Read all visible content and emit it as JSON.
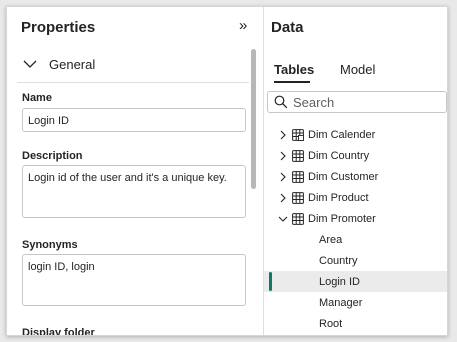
{
  "properties": {
    "title": "Properties",
    "collapse_glyph": "»",
    "section": {
      "label": "General"
    },
    "name": {
      "label": "Name",
      "value": "Login ID"
    },
    "description": {
      "label": "Description",
      "value": "Login id of the user and it's a unique key."
    },
    "synonyms": {
      "label": "Synonyms",
      "value": "login ID, login"
    },
    "next_label": "Display folder"
  },
  "data_pane": {
    "title": "Data",
    "tabs": [
      {
        "label": "Tables",
        "active": true
      },
      {
        "label": "Model",
        "active": false
      }
    ],
    "search": {
      "placeholder": "Search"
    },
    "tables": [
      {
        "name": "Dim Calender",
        "expanded": false,
        "icon": "calendar-table-icon"
      },
      {
        "name": "Dim Country",
        "expanded": false,
        "icon": "table-icon"
      },
      {
        "name": "Dim Customer",
        "expanded": false,
        "icon": "table-icon"
      },
      {
        "name": "Dim Product",
        "expanded": false,
        "icon": "table-icon"
      },
      {
        "name": "Dim Promoter",
        "expanded": true,
        "icon": "table-icon"
      }
    ],
    "fields": [
      {
        "name": "Area",
        "selected": false
      },
      {
        "name": "Country",
        "selected": false
      },
      {
        "name": "Login ID",
        "selected": true
      },
      {
        "name": "Manager",
        "selected": false
      },
      {
        "name": "Root",
        "selected": false
      }
    ]
  },
  "colors": {
    "accent": "#117865",
    "selected_row": "#ebebeb",
    "text": "#252423",
    "border": "#c8c6c4"
  }
}
